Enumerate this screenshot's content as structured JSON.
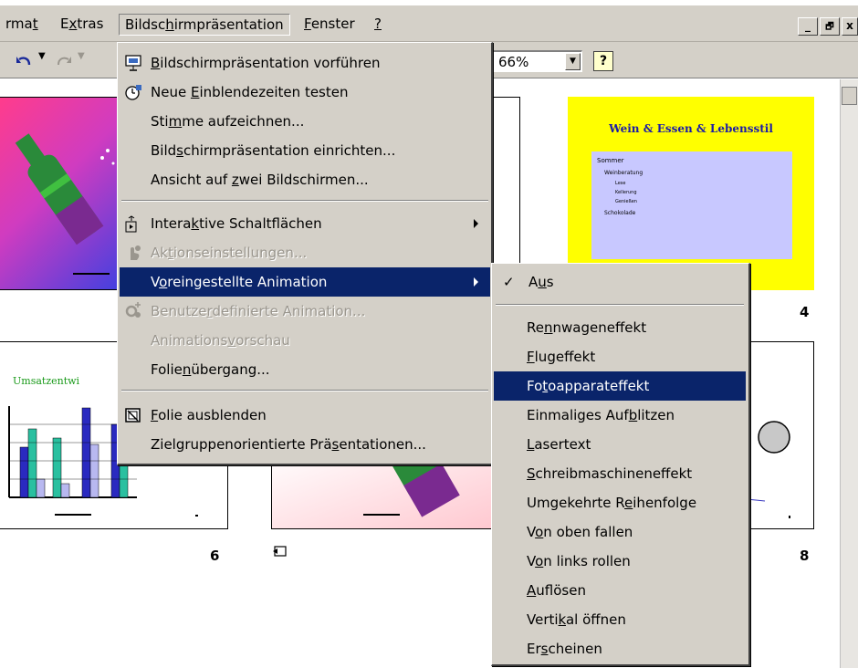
{
  "menubar": {
    "items": [
      {
        "label": "rmat",
        "underline_index": 3
      },
      {
        "label": "Extras",
        "underline_index": 1
      },
      {
        "label": "Bildschirmpräsentation",
        "underline_index": 6
      },
      {
        "label": "Fenster",
        "underline_index": 0
      },
      {
        "label": "?",
        "underline_index": 0
      }
    ],
    "window_buttons": [
      "_",
      "🗗",
      "x"
    ]
  },
  "toolbar": {
    "zoom_value": "66%",
    "help_label": "?"
  },
  "main_menu": {
    "items": [
      {
        "label": "Bildschirmpräsentation vorführen",
        "icon": "slideshow-icon",
        "state": "normal"
      },
      {
        "label": "Neue Einblendezeiten testen",
        "icon": "rehearse-timings-icon",
        "state": "normal"
      },
      {
        "label": "Stimme aufzeichnen...",
        "state": "normal"
      },
      {
        "label": "Bildschirmpräsentation einrichten...",
        "state": "normal"
      },
      {
        "label": "Ansicht auf zwei Bildschirmen...",
        "state": "normal"
      },
      {
        "label": "Interaktive Schaltflächen",
        "icon": "action-buttons-icon",
        "state": "normal",
        "submenu": true
      },
      {
        "label": "Aktionseinstellungen...",
        "icon": "action-settings-icon",
        "state": "disabled"
      },
      {
        "label": "Voreingestellte Animation",
        "state": "selected",
        "submenu": true
      },
      {
        "label": "Benutzerdefinierte Animation...",
        "icon": "custom-animation-icon",
        "state": "disabled"
      },
      {
        "label": "Animationsvorschau",
        "state": "disabled"
      },
      {
        "label": "Folienübergang...",
        "state": "normal"
      },
      {
        "label": "Folie ausblenden",
        "icon": "hide-slide-icon",
        "state": "normal"
      },
      {
        "label": "Zielgruppenorientierte Präsentationen...",
        "state": "normal"
      }
    ]
  },
  "submenu": {
    "items": [
      {
        "label": "Aus",
        "checked": true,
        "state": "normal"
      },
      {
        "label": "Rennwageneffekt",
        "state": "normal"
      },
      {
        "label": "Flugeffekt",
        "state": "normal"
      },
      {
        "label": "Fotoapparateffekt",
        "state": "selected"
      },
      {
        "label": "Einmaliges Aufblitzen",
        "state": "normal"
      },
      {
        "label": "Lasertext",
        "state": "normal"
      },
      {
        "label": "Schreibmaschineneffekt",
        "state": "normal"
      },
      {
        "label": "Umgekehrte Reihenfolge",
        "state": "normal"
      },
      {
        "label": "Von oben fallen",
        "state": "normal"
      },
      {
        "label": "Von links rollen",
        "state": "normal"
      },
      {
        "label": "Auflösen",
        "state": "normal"
      },
      {
        "label": "Vertikal öffnen",
        "state": "normal"
      },
      {
        "label": "Erscheinen",
        "state": "normal"
      }
    ],
    "check_mark": "✓"
  },
  "slides": {
    "s4": {
      "title": "Wein & Essen & Lebensstil",
      "bullets": [
        "Sommer",
        "Weinberatung",
        "Lese",
        "Kellerung",
        "Genießen",
        "Schokolade"
      ],
      "number": "4"
    },
    "s6": {
      "title": "Umsatzentwi",
      "number": "6"
    },
    "s8": {
      "number": "8"
    },
    "transition_icon": "slide-transition-icon"
  },
  "colors": {
    "menu_bg": "#d4d0c8",
    "selection": "#0a246a",
    "slide4_bg": "#ffff00",
    "slide4_box": "#c8c8ff",
    "slide4_title": "#1a1aa8"
  }
}
